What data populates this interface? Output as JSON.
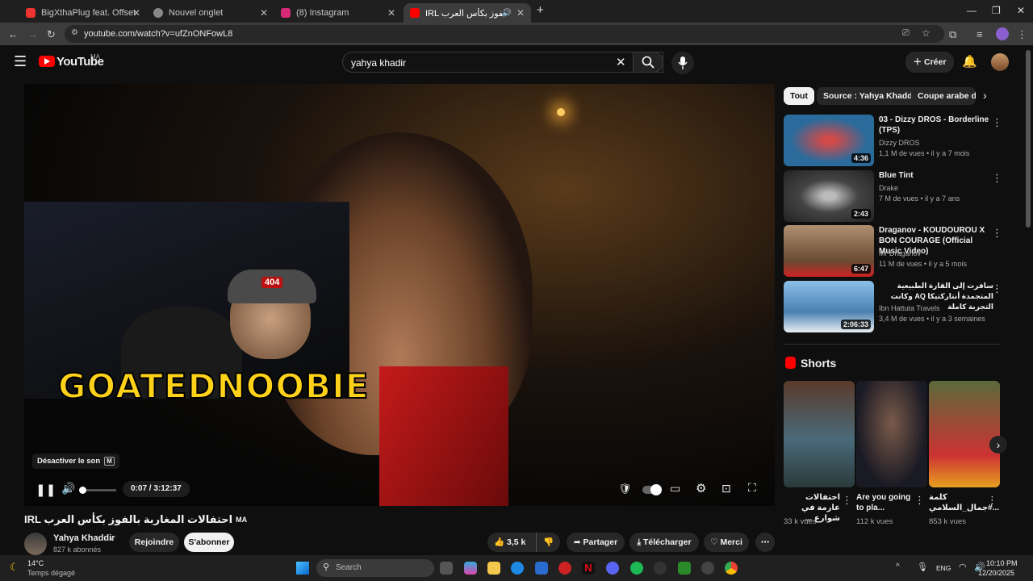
{
  "tabs": [
    {
      "title": "BigXthaPlug feat. Offset - Clim",
      "fav": "#e33"
    },
    {
      "title": "Nouvel onglet",
      "fav": "#9aa"
    },
    {
      "title": "(8) Instagram",
      "fav": "#d62976"
    },
    {
      "title": "IRL احتفالات المغاربة بالفوز بكأس العرب",
      "fav": "#f00"
    }
  ],
  "address": {
    "url": "youtube.com/watch?v=ufZnONFowL8"
  },
  "header": {
    "logo": "YouTube",
    "region": "MA",
    "search": "yahya khadir",
    "create": "Créer"
  },
  "player": {
    "overlay_brand": "GOATEDNOOBIE",
    "cap_badge": "404",
    "tooltip": "Désactiver le son",
    "tooltip_key": "M",
    "time": "0:07 / 3:12:37",
    "progress": 0.0006
  },
  "video": {
    "title": "IRL احتفالات المغاربة بالفوز بكأس العرب",
    "title_suffix": "MA",
    "channel": "Yahya Khaddir",
    "subs": "827 k abonnés",
    "join": "Rejoindre",
    "subscribe": "S'abonner",
    "likes": "3,5 k",
    "share": "Partager",
    "download": "Télécharger",
    "thanks": "Merci"
  },
  "chips": [
    "Tout",
    "Source : Yahya Khaddir",
    "Coupe arabe de"
  ],
  "recs": [
    {
      "title": "03 - Dizzy DROS - Borderline (TPS)",
      "channel": "Dizzy DROS",
      "meta": "1,1 M de vues • il y a 7 mois",
      "dur": "4:36",
      "color": "#2a6b9c"
    },
    {
      "title": "Blue Tint",
      "channel": "Drake",
      "meta": "7 M de vues • il y a 7 ans",
      "dur": "2:43",
      "color": "#444"
    },
    {
      "title": "Draganov - KOUDOUROU X BON COURAGE (Official Music Video)",
      "channel": "Mr Draganov",
      "meta": "11 M de vues • il y a 5 mois",
      "dur": "6:47",
      "color": "#8a6a4a"
    },
    {
      "title": "سافرت إلى القارة الطبيعية المتجمدة أنتاركتيكا AQ وكانت التجربة كاملة",
      "channel": "Ibn Hattuta Travels",
      "meta": "3,4 M de vues • il y a 3 semaines",
      "dur": "2:06:33",
      "color": "#6aa0d0"
    }
  ],
  "shorts": {
    "heading": "Shorts",
    "items": [
      {
        "title": "احتفالات عارمة في شوارع ...",
        "views": "33 k vues",
        "color": "#3a4a5a"
      },
      {
        "title": "Are you going to pla...",
        "views": "112 k vues",
        "color": "#2a2a3a"
      },
      {
        "title": "كلمة #جمال_السلامي...",
        "views": "853 k vues",
        "color": "#c33"
      }
    ]
  },
  "taskbar": {
    "temp": "14°C",
    "weather": "Temps dégagé",
    "search": "Search",
    "lang": "ENG",
    "time": "10:10 PM",
    "date": "12/20/2025"
  }
}
